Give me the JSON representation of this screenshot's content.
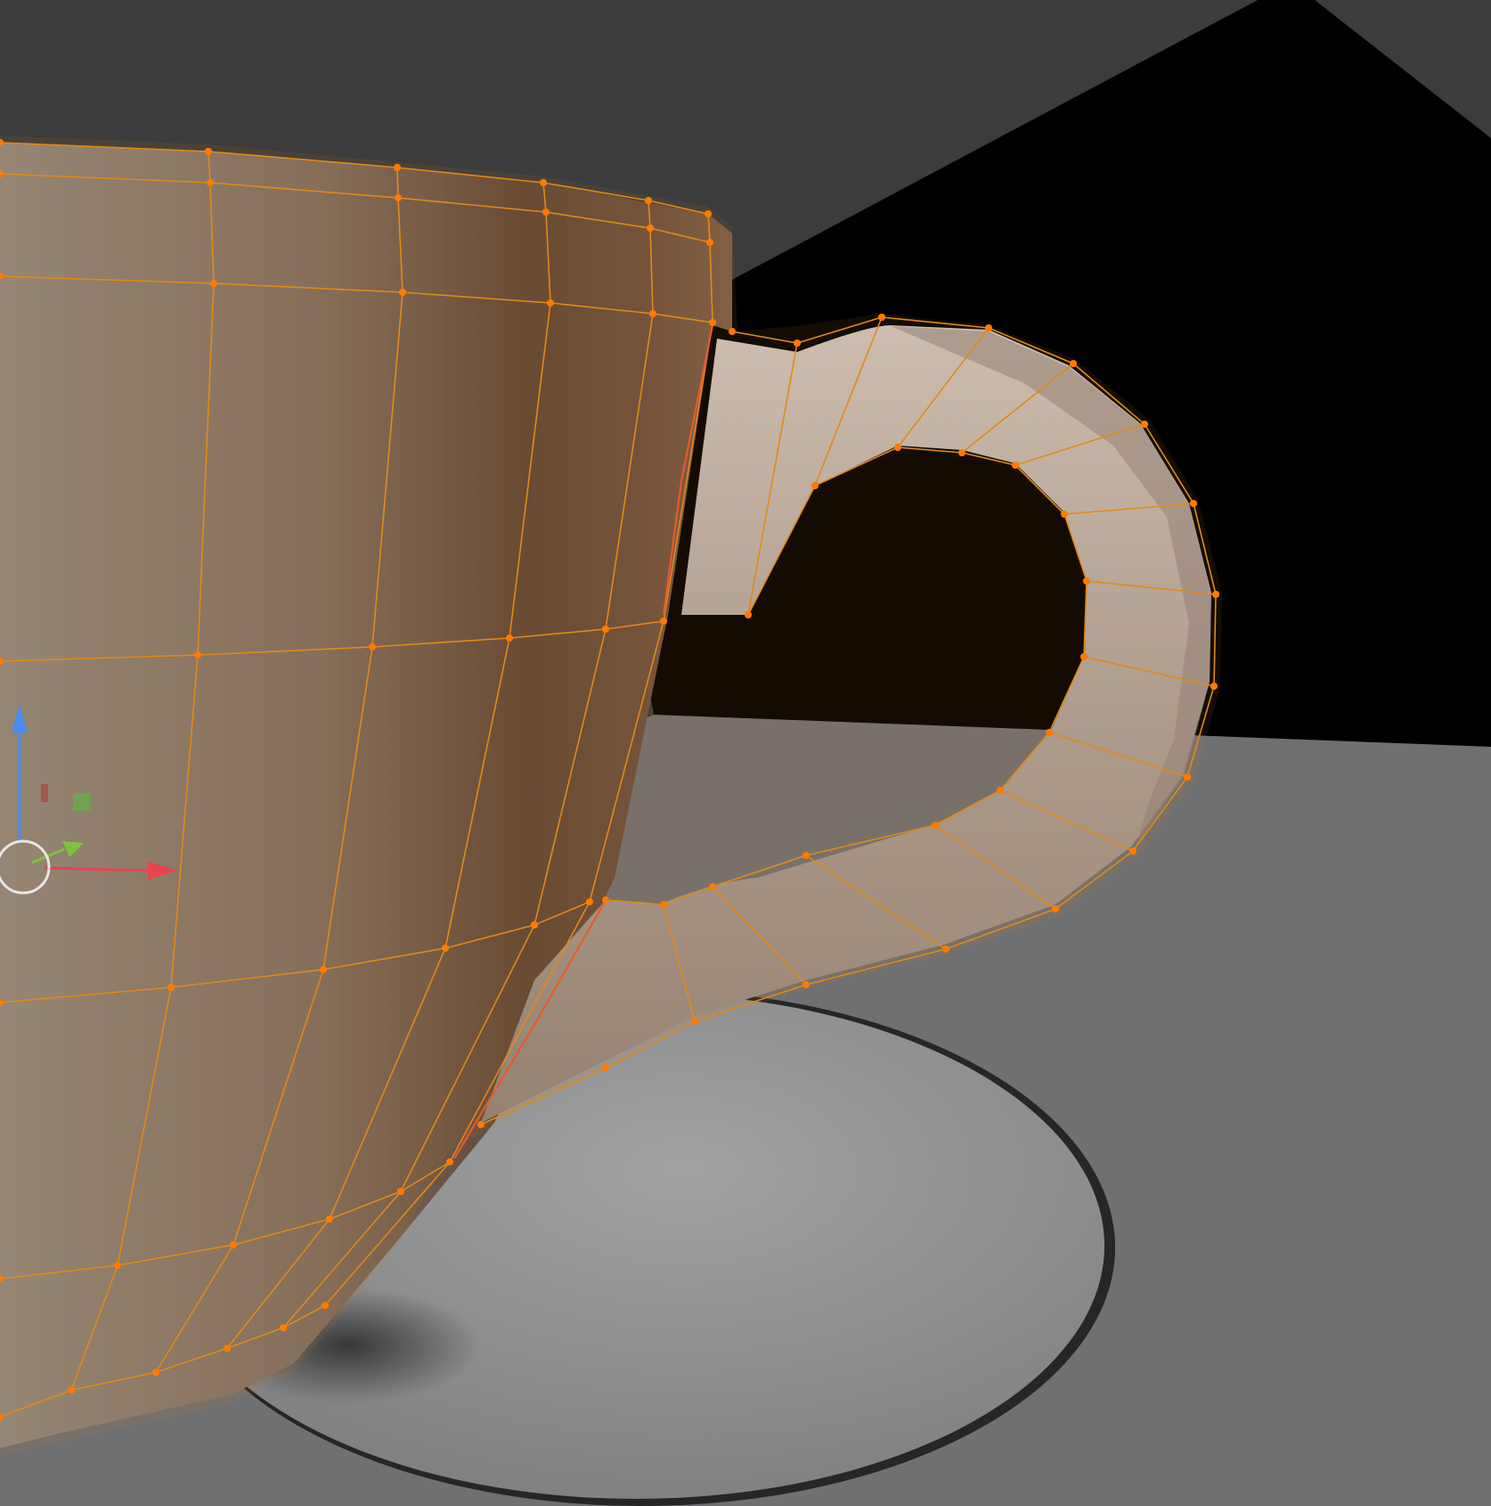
{
  "viewport": {
    "background_color": "#3c3c3c",
    "shadow_color": "#000000",
    "floor_color": "#6e7072"
  },
  "object": {
    "body_light_color": "#8c8279",
    "body_dark_color": "#5c4434",
    "handle_color": "#bdb3ae",
    "edit_mode": true,
    "selected": true,
    "wire_color": "#e08a18",
    "vertex_color": "#ff7a00",
    "seam_color": "#e85a2a"
  },
  "saucer": {
    "color": "#8e9092",
    "rim_color": "#2a2a2a"
  },
  "gizmo": {
    "z_axis_color": "#4a8cf0",
    "x_axis_color": "#e8434f",
    "y_axis_color": "#7fc23e",
    "plane_xz_color": "#a84a4a",
    "plane_yz_color": "#6ca84a",
    "origin_ring_color": "#e6e6e6"
  }
}
